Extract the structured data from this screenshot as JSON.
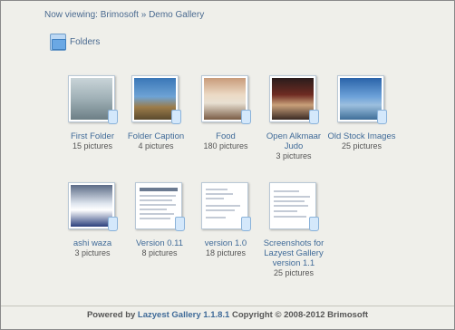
{
  "breadcrumb": {
    "prefix": "Now viewing: ",
    "home": "Brimosoft",
    "separator": " » ",
    "current": "Demo Gallery"
  },
  "folders_heading": "Folders",
  "folders": [
    {
      "title": "First Folder",
      "count": "15 pictures",
      "thumb": "img-first"
    },
    {
      "title": "Folder Caption",
      "count": "4 pictures",
      "thumb": "img-caption"
    },
    {
      "title": "Food",
      "count": "180 pictures",
      "thumb": "img-food"
    },
    {
      "title": "Open Alkmaar Judo",
      "count": "3 pictures",
      "thumb": "img-judo"
    },
    {
      "title": "Old Stock Images",
      "count": "25 pictures",
      "thumb": "img-stock"
    },
    {
      "title": "ashi waza",
      "count": "3 pictures",
      "thumb": "img-ashi"
    },
    {
      "title": "Version 0.11",
      "count": "8 pictures",
      "thumb": "img-shot"
    },
    {
      "title": "version 1.0",
      "count": "18 pictures",
      "thumb": "img-shot"
    },
    {
      "title": "Screenshots for Lazyest Gallery version 1.1",
      "count": "25 pictures",
      "thumb": "img-shot"
    }
  ],
  "footer": {
    "prefix": "Powered by ",
    "link": "Lazyest Gallery 1.1.8.1",
    "suffix": " Copyright © 2008-2012 Brimosoft"
  }
}
